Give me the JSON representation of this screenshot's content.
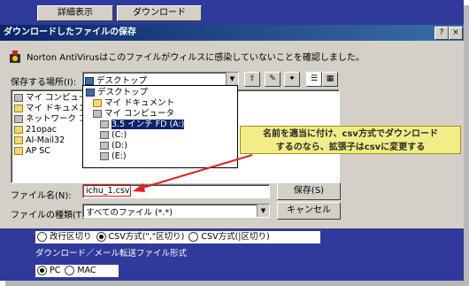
{
  "web": {
    "detail_button": "詳細表示",
    "download_button": "ダウンロード"
  },
  "dialog": {
    "title": "ダウンロードしたファイルの保存",
    "message": "Norton AntiVirusはこのファイルがウィルスに感染していないことを確認しました。",
    "save_in_label": "保存する場所(I):",
    "save_in_value": "デスクトップ",
    "left_list": [
      "マイ コンピュータ",
      "マイ ドキュメント",
      "ネットワーク コンピュータ",
      "21opac",
      "AI-Mail32",
      "AP SC"
    ],
    "dropdown_items": [
      "デスクトップ",
      "マイ ドキュメント",
      "マイ コンピュータ",
      "3.5 インチ FD (A:)",
      "(C:)",
      "(D:)",
      "(E:)"
    ],
    "filename_label": "ファイル名(N):",
    "filename_value": "ichu_1.csv",
    "filetype_label": "ファイルの種類(T):",
    "filetype_value": "すべてのファイル (*.*)",
    "save_button": "保存(S)",
    "cancel_button": "キャンセル"
  },
  "annotation": {
    "line1": "名前を適当に付け、csv方式でダウンロード",
    "line2": "するのなら、拡張子はcsvに変更する"
  },
  "bottom": {
    "opt1": "改行区切り",
    "opt2": "CSV方式(\",\"区切り)",
    "opt3": "CSV方式(|区切り)",
    "section_title": "ダウンロード／メール転送ファイル形式",
    "pc": "PC",
    "mac": "MAC"
  },
  "colors": {
    "frame": "#2f3a9a",
    "dialog": "#d4d0c8",
    "callout": "#f2ed86",
    "arrow": "#e02020"
  }
}
